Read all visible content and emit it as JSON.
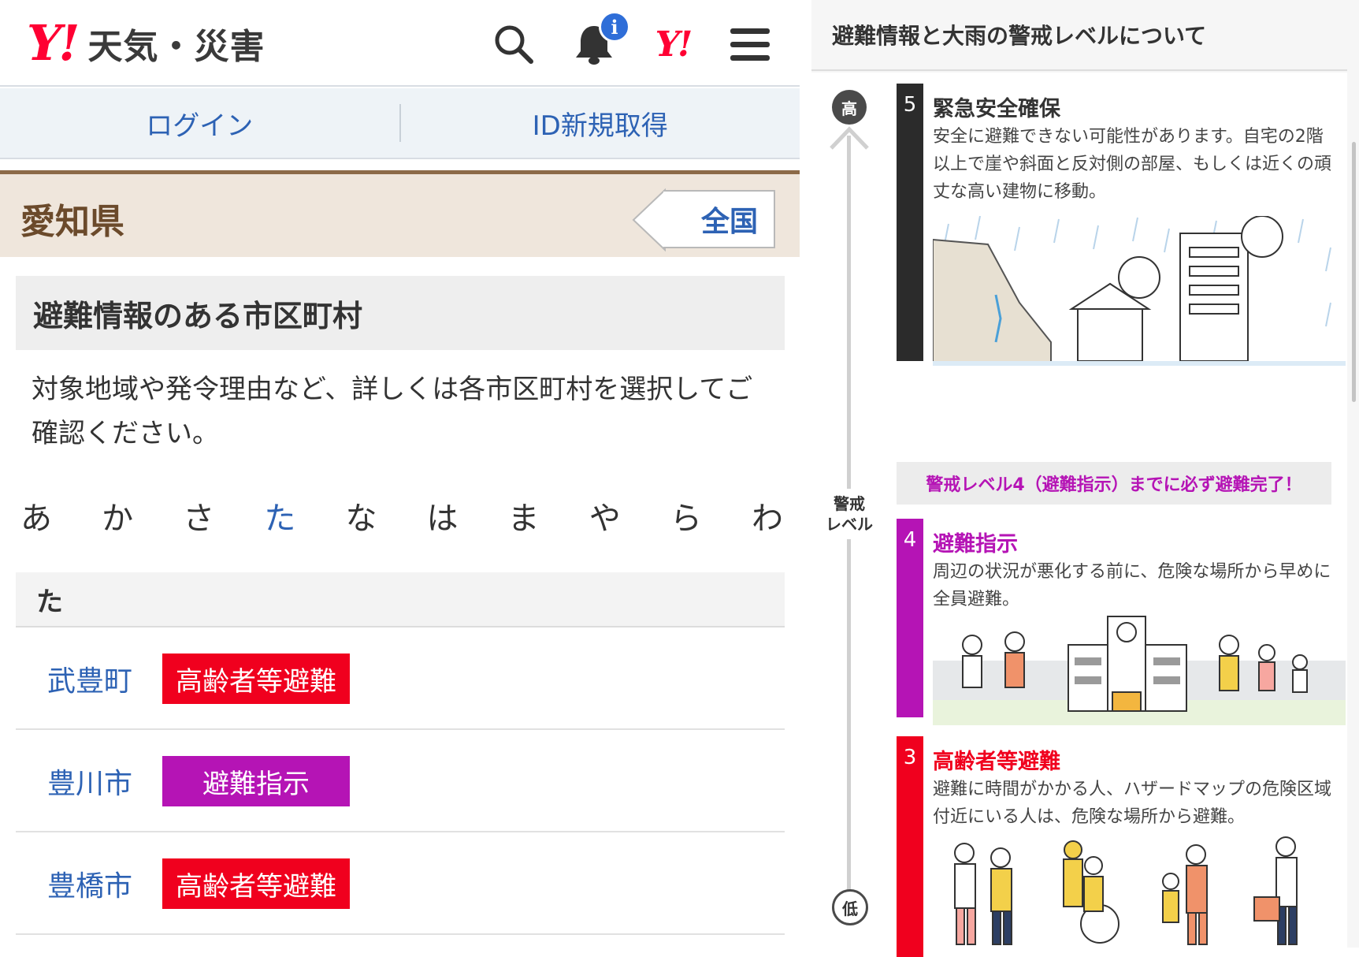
{
  "colors": {
    "brand_red": "#ff0033",
    "link_blue": "#2d62b4",
    "pref_brown": "#6b4a2b",
    "level5": "#2b2b2b",
    "level4": "#b514b5",
    "level3": "#f0001e",
    "tag_red": "#f0001e",
    "tag_purple": "#b514b5"
  },
  "header": {
    "logo_mark": "Y!",
    "service_name": "天気・災害",
    "search_icon": "search-icon",
    "bell_icon": "bell-icon",
    "notification_badge": "i",
    "yahoo_mark": "Y!",
    "menu_icon": "menu-icon"
  },
  "auth": {
    "login": "ログイン",
    "signup": "ID新規取得"
  },
  "prefecture": {
    "name": "愛知県",
    "nationwide_button": "全国"
  },
  "section": {
    "title": "避難情報のある市区町村",
    "description": "対象地域や発令理由など、詳しくは各市区町村を選択してご確認ください。"
  },
  "kana_index": [
    {
      "label": "あ",
      "active": false
    },
    {
      "label": "か",
      "active": false
    },
    {
      "label": "さ",
      "active": false
    },
    {
      "label": "た",
      "active": true
    },
    {
      "label": "な",
      "active": false
    },
    {
      "label": "は",
      "active": false
    },
    {
      "label": "ま",
      "active": false
    },
    {
      "label": "や",
      "active": false
    },
    {
      "label": "ら",
      "active": false
    },
    {
      "label": "わ",
      "active": false
    }
  ],
  "group": {
    "heading": "た",
    "municipalities": [
      {
        "name": "武豊町",
        "status": "高齢者等避難",
        "status_color": "#f0001e"
      },
      {
        "name": "豊川市",
        "status": "避難指示",
        "status_color": "#b514b5"
      },
      {
        "name": "豊橋市",
        "status": "高齢者等避難",
        "status_color": "#f0001e"
      }
    ]
  },
  "levels_panel": {
    "title": "避難情報と大雨の警戒レベルについて",
    "axis_high": "高",
    "axis_low": "低",
    "axis_label": "警戒\nレベル",
    "levels": [
      {
        "number": "5",
        "title": "緊急安全確保",
        "description": "安全に避難できない可能性があります。自宅の2階以上で崖や斜面と反対側の部屋、もしくは近くの頑丈な高い建物に移動。",
        "color": "#2b2b2b"
      },
      {
        "number": "4",
        "title": "避難指示",
        "description": "周辺の状況が悪化する前に、危険な場所から早めに全員避難。",
        "color": "#b514b5"
      },
      {
        "number": "3",
        "title": "高齢者等避難",
        "description": "避難に時間がかかる人、ハザードマップの危険区域付近にいる人は、危険な場所から避難。",
        "color": "#f0001e"
      }
    ],
    "evacuation_deadline": "警戒レベル4（避難指示）までに必ず避難完了！"
  }
}
